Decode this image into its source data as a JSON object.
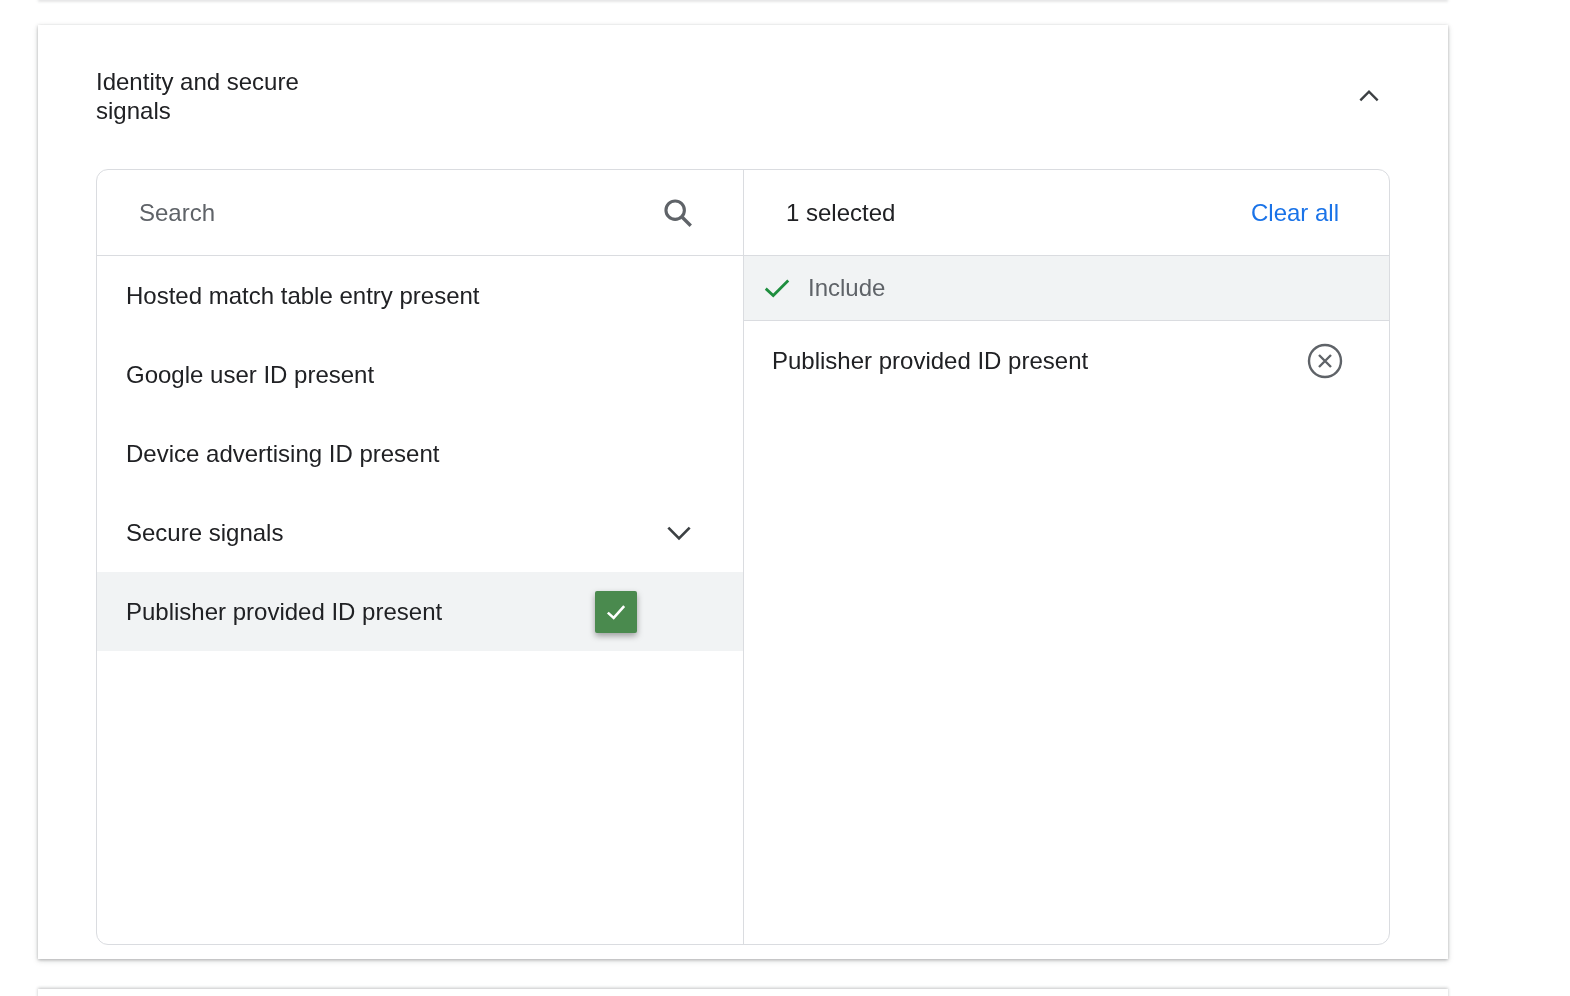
{
  "section": {
    "title": "Identity and secure signals",
    "expanded": true
  },
  "picker": {
    "search": {
      "placeholder": "Search"
    },
    "options": [
      {
        "kind": "item",
        "label": "Hosted match table entry present",
        "selected": false,
        "checked": false
      },
      {
        "kind": "item",
        "label": "Google user ID present",
        "selected": false,
        "checked": false
      },
      {
        "kind": "item",
        "label": "Device advertising ID present",
        "selected": false,
        "checked": false
      },
      {
        "kind": "group",
        "label": "Secure signals",
        "selected": false,
        "expanded": false
      },
      {
        "kind": "item",
        "label": "Publisher provided ID present",
        "selected": true,
        "checked": true
      }
    ],
    "summary": {
      "count": "1 selected",
      "clear": "Clear all"
    },
    "include": {
      "label": "Include"
    },
    "chosen": [
      {
        "label": "Publisher provided ID present"
      }
    ]
  }
}
